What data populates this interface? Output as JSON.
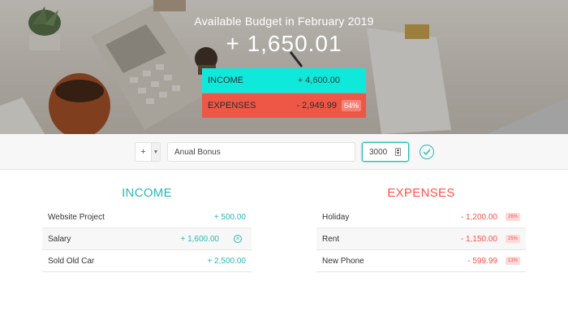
{
  "header": {
    "title": "Available Budget in February 2019",
    "total": "+ 1,650.01",
    "income": {
      "label": "INCOME",
      "value": "+ 4,600.00"
    },
    "expenses": {
      "label": "EXPENSES",
      "value": "- 2,949.99",
      "percentage": "64%"
    }
  },
  "add_form": {
    "type_value": "+",
    "description_value": "Anual Bonus",
    "amount_value": "3000"
  },
  "income": {
    "title": "INCOME",
    "items": [
      {
        "description": "Website Project",
        "value": "+ 500.00"
      },
      {
        "description": "Salary",
        "value": "+ 1,600.00"
      },
      {
        "description": "Sold Old Car",
        "value": "+ 2,500.00"
      }
    ]
  },
  "expenses": {
    "title": "EXPENSES",
    "items": [
      {
        "description": "Holiday",
        "value": "- 1,200.00",
        "percentage": "26%"
      },
      {
        "description": "Rent",
        "value": "- 1,150.00",
        "percentage": "25%"
      },
      {
        "description": "New Phone",
        "value": "- 599.99",
        "percentage": "13%"
      }
    ]
  },
  "colors": {
    "income_accent": "#28b9b5",
    "expense_accent": "#ff5049",
    "income_bar": "#0fe9dc",
    "expense_bar": "#ee5745"
  }
}
